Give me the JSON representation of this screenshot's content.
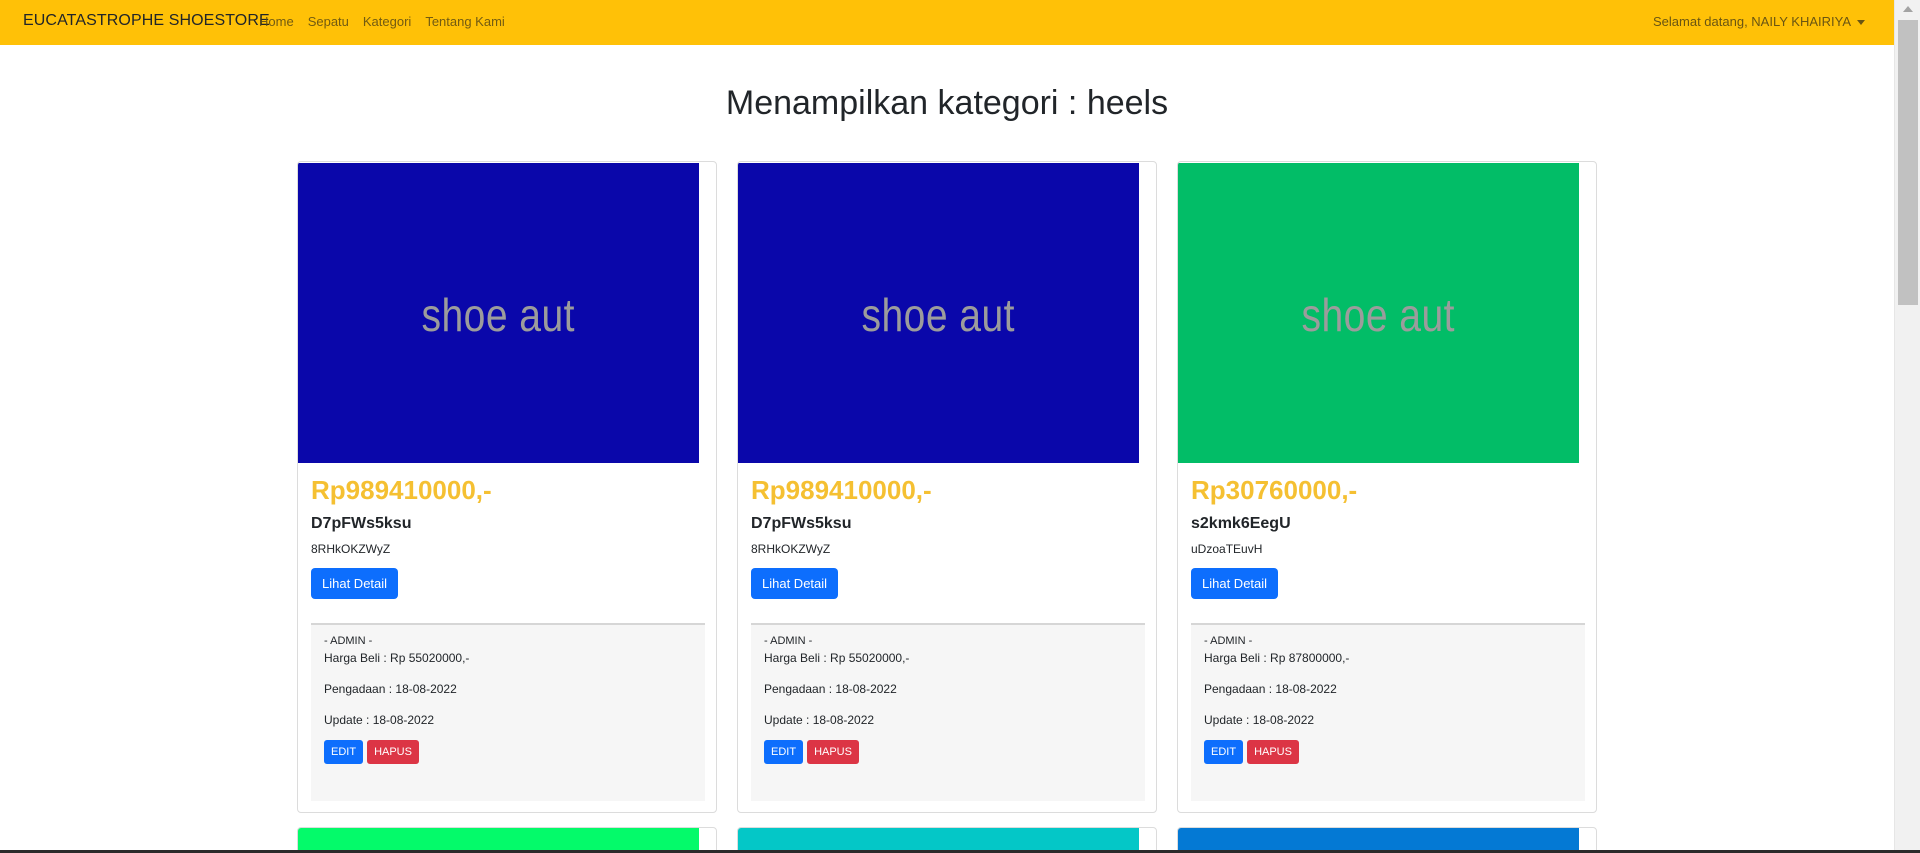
{
  "navbar": {
    "brand": "EUCATASTROPHE SHOESTORE",
    "links": [
      "Home",
      "Sepatu",
      "Kategori",
      "Tentang Kami"
    ],
    "user_greeting": "Selamat datang, NAILY KHAIRIYA",
    "background_color": "#ffc107"
  },
  "page": {
    "title": "Menampilkan kategori : heels"
  },
  "buttons": {
    "detail_label": "Lihat Detail",
    "edit_label": "EDIT",
    "delete_label": "HAPUS"
  },
  "admin": {
    "label": "- ADMIN -"
  },
  "products": [
    {
      "image_text": "shoe aut",
      "image_color": "#0a07aa",
      "price": "Rp989410000,-",
      "name": "D7pFWs5ksu",
      "code": "8RHkOKZWyZ",
      "harga_beli": "Harga Beli : Rp 55020000,-",
      "pengadaan": "Pengadaan : 18-08-2022",
      "update": "Update : 18-08-2022"
    },
    {
      "image_text": "shoe aut",
      "image_color": "#0a07aa",
      "price": "Rp989410000,-",
      "name": "D7pFWs5ksu",
      "code": "8RHkOKZWyZ",
      "harga_beli": "Harga Beli : Rp 55020000,-",
      "pengadaan": "Pengadaan : 18-08-2022",
      "update": "Update : 18-08-2022"
    },
    {
      "image_text": "shoe aut",
      "image_color": "#02bd67",
      "price": "Rp30760000,-",
      "name": "s2kmk6EegU",
      "code": "uDzoaTEuvH",
      "harga_beli": "Harga Beli : Rp 87800000,-",
      "pengadaan": "Pengadaan : 18-08-2022",
      "update": "Update : 18-08-2022"
    }
  ],
  "next_row_colors": [
    "#04fa6a",
    "#04c7c7",
    "#0479d4"
  ],
  "colors": {
    "price": "#f5c032",
    "primary": "#0d6efd",
    "danger": "#dc3545"
  }
}
